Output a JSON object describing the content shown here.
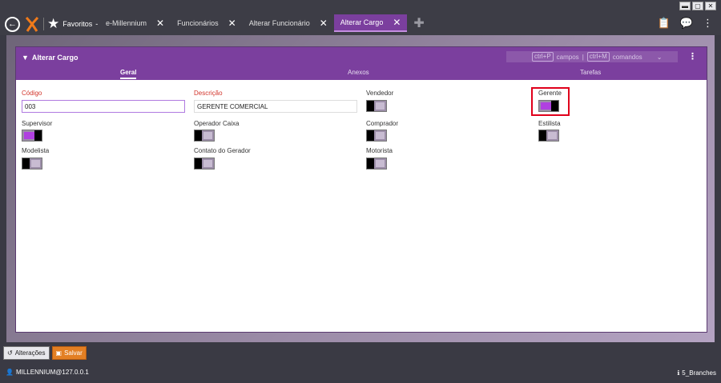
{
  "window_controls": [
    "▬",
    "▢",
    "✕"
  ],
  "favorites_label": "Favoritos",
  "favorites_caret": "-",
  "tabs": [
    {
      "label": "e-Millennium"
    },
    {
      "label": "Funcionários"
    },
    {
      "label": "Alterar Funcionário"
    },
    {
      "label": "Alterar Cargo",
      "active": true
    }
  ],
  "panel": {
    "title": "Alterar Cargo",
    "shortcut_fields_key": "ctrl+P",
    "shortcut_fields_label": "campos",
    "shortcut_sep": "|",
    "shortcut_commands_key": "ctrl+M",
    "shortcut_commands_label": "comandos",
    "sub_tabs": [
      "Geral",
      "Anexos",
      "Tarefas"
    ]
  },
  "form": {
    "codigo_label": "Código",
    "codigo_value": "003",
    "descricao_label": "Descrição",
    "descricao_value": "GERENTE COMERCIAL",
    "vendedor": {
      "label": "Vendedor",
      "checked": false
    },
    "gerente": {
      "label": "Gerente",
      "checked": true
    },
    "supervisor": {
      "label": "Supervisor",
      "checked": true
    },
    "operador_caixa": {
      "label": "Operador Caixa",
      "checked": false
    },
    "comprador": {
      "label": "Comprador",
      "checked": false
    },
    "estilista": {
      "label": "Estilista",
      "checked": false
    },
    "modelista": {
      "label": "Modelista",
      "checked": false
    },
    "contato_gerador": {
      "label": "Contato do Gerador",
      "checked": false
    },
    "motorista": {
      "label": "Motorista",
      "checked": false
    }
  },
  "actions": {
    "alteracoes_label": "Alterações",
    "salvar_label": "Salvar"
  },
  "status": {
    "user": "MILLENNIUM@127.0.0.1",
    "branches": "5_Branches"
  },
  "colors": {
    "accent": "#7b3f9e",
    "toggle_on": "#b040e0",
    "required": "#d2342b",
    "save": "#e37f23"
  }
}
